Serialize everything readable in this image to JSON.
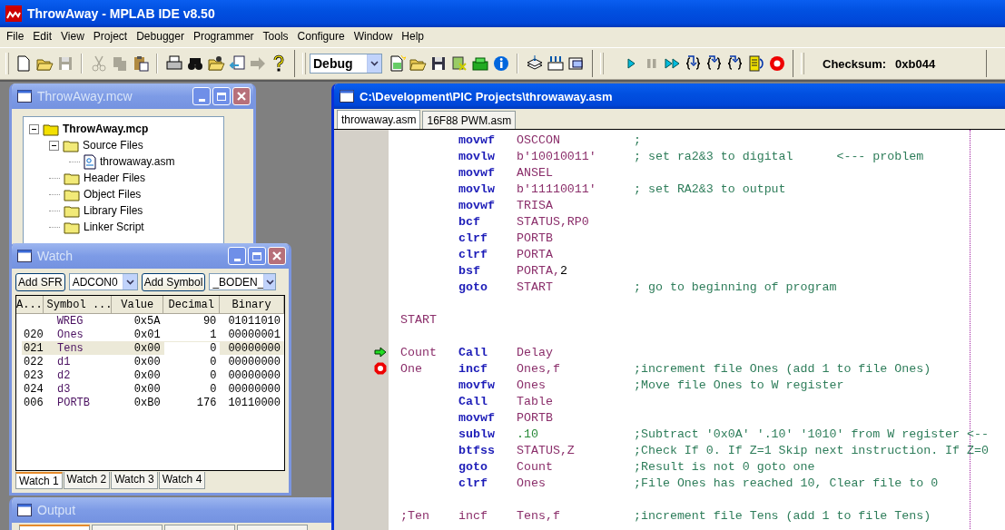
{
  "window": {
    "title": "ThrowAway - MPLAB IDE v8.50"
  },
  "menu": [
    "File",
    "Edit",
    "View",
    "Project",
    "Debugger",
    "Programmer",
    "Tools",
    "Configure",
    "Window",
    "Help"
  ],
  "toolbar": {
    "standard": [
      {
        "disabled": false
      },
      {
        "disabled": false
      },
      {
        "disabled": true
      },
      {
        "disabled": true
      },
      {
        "disabled": true
      },
      {
        "disabled": false
      },
      {
        "disabled": false
      },
      {
        "disabled": false
      },
      {
        "disabled": false
      },
      {
        "disabled": false
      },
      {
        "disabled": true
      },
      {
        "disabled": false
      }
    ],
    "build_config": "Debug",
    "debug": [
      {
        "disabled": false
      },
      {
        "disabled": true
      },
      {
        "disabled": false
      },
      {
        "disabled": false
      },
      {
        "disabled": false
      },
      {
        "disabled": false
      },
      {
        "disabled": false
      },
      {
        "disabled": false
      }
    ],
    "checksum_label": "Checksum:",
    "checksum": "0xb044"
  },
  "project": {
    "title": "ThrowAway.mcw",
    "active": false,
    "tree": [
      {
        "label": "ThrowAway.mcp",
        "kind": "project",
        "expanded": true,
        "children": [
          {
            "label": "Source Files",
            "kind": "folder",
            "expanded": true,
            "children": [
              {
                "label": "throwaway.asm",
                "kind": "file"
              }
            ]
          },
          {
            "label": "Header Files",
            "kind": "folder"
          },
          {
            "label": "Object Files",
            "kind": "folder"
          },
          {
            "label": "Library Files",
            "kind": "folder"
          },
          {
            "label": "Linker Script",
            "kind": "folder"
          }
        ]
      }
    ]
  },
  "watch": {
    "title": "Watch",
    "active": false,
    "add_sfr": "Add SFR",
    "sfr": "ADCON0",
    "add_symbol": "Add Symbol",
    "symbol": "_BODEN_",
    "columns": [
      "A...",
      "Symbol ...",
      "Value",
      "Decimal",
      "Binary"
    ],
    "rows": [
      {
        "symbol": "WREG",
        "value": "0x5A",
        "decimal": "90",
        "binary": "01011010",
        "selected": false
      },
      {
        "address": "020",
        "symbol": "Ones",
        "value": "0x01",
        "decimal": "1",
        "binary": "00000001",
        "selected": false
      },
      {
        "address": "021",
        "symbol": "Tens",
        "value": "0x00",
        "decimal": "0",
        "binary": "00000000",
        "selected": true
      },
      {
        "address": "022",
        "symbol": "d1",
        "value": "0x00",
        "decimal": "0",
        "binary": "00000000",
        "selected": false
      },
      {
        "address": "023",
        "symbol": "d2",
        "value": "0x00",
        "decimal": "0",
        "binary": "00000000",
        "selected": false
      },
      {
        "address": "024",
        "symbol": "d3",
        "value": "0x00",
        "decimal": "0",
        "binary": "00000000",
        "selected": false
      },
      {
        "address": "006",
        "symbol": "PORTB",
        "value": "0xB0",
        "decimal": "176",
        "binary": "10110000",
        "selected": false
      }
    ],
    "tabs": [
      {
        "label": "Watch 1",
        "selected": true
      },
      {
        "label": "Watch 2",
        "selected": false
      },
      {
        "label": "Watch 3",
        "selected": false
      },
      {
        "label": "Watch 4",
        "selected": false
      }
    ]
  },
  "output": {
    "title": "Output",
    "active": false
  },
  "editor": {
    "title": "C:\\Development\\PIC Projects\\throwaway.asm",
    "active": true,
    "tabs": [
      {
        "label": "throwaway.asm",
        "selected": true
      },
      {
        "label": "16F88 PWM.asm",
        "selected": false
      }
    ],
    "lines": [
      {
        "kind": "code",
        "op": "movwf",
        "keyword": true,
        "args": [
          {
            "text": "OSCCON",
            "kind": "symbol"
          }
        ],
        "comment": ";"
      },
      {
        "kind": "code",
        "op": "movlw",
        "keyword": true,
        "args": [
          {
            "text": "b'10010011'",
            "kind": "symbol"
          }
        ],
        "comment": "; set ra2&3 to digital      <--- problem"
      },
      {
        "kind": "code",
        "op": "movwf",
        "keyword": true,
        "args": [
          {
            "text": "ANSEL",
            "kind": "symbol"
          }
        ]
      },
      {
        "kind": "code",
        "op": "movlw",
        "keyword": true,
        "args": [
          {
            "text": "b'11110011'",
            "kind": "symbol"
          }
        ],
        "comment": "; set RA2&3 to output"
      },
      {
        "kind": "code",
        "op": "movwf",
        "keyword": true,
        "args": [
          {
            "text": "TRISA",
            "kind": "symbol"
          }
        ]
      },
      {
        "kind": "code",
        "op": "bcf",
        "keyword": true,
        "args": [
          {
            "text": "STATUS,RP0",
            "kind": "symbol"
          }
        ]
      },
      {
        "kind": "code",
        "op": "clrf",
        "keyword": true,
        "args": [
          {
            "text": "PORTB",
            "kind": "symbol"
          }
        ]
      },
      {
        "kind": "code",
        "op": "clrf",
        "keyword": true,
        "args": [
          {
            "text": "PORTA",
            "kind": "symbol"
          }
        ]
      },
      {
        "kind": "code",
        "op": "bsf",
        "keyword": true,
        "args": [
          {
            "text": "PORTA,",
            "kind": "symbol"
          },
          {
            "text": "2",
            "kind": "plain"
          }
        ]
      },
      {
        "kind": "code",
        "op": "goto",
        "keyword": true,
        "args": [
          {
            "text": "START",
            "kind": "symbol"
          }
        ],
        "comment": "; go to beginning of program"
      },
      {
        "kind": "blank"
      },
      {
        "kind": "code",
        "label": "START"
      },
      {
        "kind": "blank"
      },
      {
        "kind": "code",
        "label": "Count",
        "op": "Call",
        "keyword": true,
        "args": [
          {
            "text": "Delay",
            "kind": "symbol"
          }
        ],
        "current": true
      },
      {
        "kind": "code",
        "label": "One",
        "op": "incf",
        "keyword": true,
        "args": [
          {
            "text": "Ones,f",
            "kind": "symbol"
          }
        ],
        "comment": ";increment file Ones (add 1 to file Ones)",
        "breakpoint": true
      },
      {
        "kind": "code",
        "op": "movfw",
        "keyword": true,
        "args": [
          {
            "text": "Ones",
            "kind": "symbol"
          }
        ],
        "comment": ";Move file Ones to W register"
      },
      {
        "kind": "code",
        "op": "Call",
        "keyword": true,
        "args": [
          {
            "text": "Table",
            "kind": "symbol"
          }
        ]
      },
      {
        "kind": "code",
        "op": "movwf",
        "keyword": true,
        "args": [
          {
            "text": "PORTB",
            "kind": "symbol"
          }
        ]
      },
      {
        "kind": "code",
        "op": "sublw",
        "keyword": true,
        "args": [
          {
            "text": ".10",
            "kind": "number"
          }
        ],
        "comment": ";Subtract '0x0A' '.10' '1010' from W register <--"
      },
      {
        "kind": "code",
        "op": "btfss",
        "keyword": true,
        "args": [
          {
            "text": "STATUS,Z",
            "kind": "symbol"
          }
        ],
        "comment": ";Check If 0. If Z=1 Skip next instruction. If Z=0"
      },
      {
        "kind": "code",
        "op": "goto",
        "keyword": true,
        "args": [
          {
            "text": "Count",
            "kind": "symbol"
          }
        ],
        "comment": ";Result is not 0 goto one"
      },
      {
        "kind": "code",
        "op": "clrf",
        "keyword": true,
        "args": [
          {
            "text": "Ones",
            "kind": "symbol"
          }
        ],
        "comment": ";File Ones has reached 10, Clear file to 0"
      },
      {
        "kind": "blank"
      },
      {
        "kind": "code",
        "label": ";Ten",
        "op": "incf",
        "keyword": false,
        "args": [
          {
            "text": "Tens,f",
            "kind": "symbol"
          }
        ],
        "comment": ";increment file Tens (add 1 to file Tens)"
      }
    ]
  }
}
